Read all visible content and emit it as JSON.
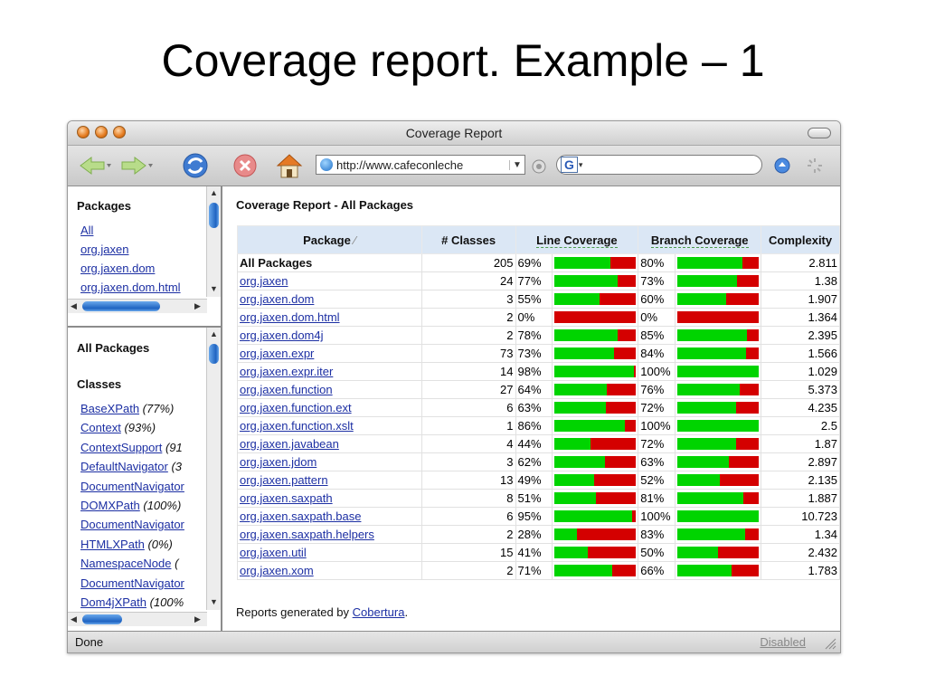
{
  "slide": {
    "title": "Coverage report. Example – 1"
  },
  "window": {
    "title": "Coverage Report",
    "url": "http://www.cafeconleche",
    "search_engine": "G"
  },
  "left_top": {
    "heading": "Packages",
    "items": [
      "All",
      "org.jaxen",
      "org.jaxen.dom",
      "org.jaxen.dom.html"
    ]
  },
  "left_bottom": {
    "heading": "All Packages",
    "subheading": "Classes",
    "classes": [
      {
        "name": "BaseXPath",
        "pct": "(77%)"
      },
      {
        "name": "Context",
        "pct": "(93%)"
      },
      {
        "name": "ContextSupport",
        "pct": "(91"
      },
      {
        "name": "DefaultNavigator",
        "pct": "(3"
      },
      {
        "name": "DocumentNavigator",
        "pct": ""
      },
      {
        "name": "DOMXPath",
        "pct": "(100%)"
      },
      {
        "name": "DocumentNavigator",
        "pct": ""
      },
      {
        "name": "HTMLXPath",
        "pct": "(0%)"
      },
      {
        "name": "NamespaceNode",
        "pct": "("
      },
      {
        "name": "DocumentNavigator",
        "pct": ""
      },
      {
        "name": "Dom4jXPath",
        "pct": "(100%"
      }
    ]
  },
  "main": {
    "title": "Coverage Report - All Packages",
    "headers": {
      "package": "Package",
      "classes": "# Classes",
      "line": "Line Coverage",
      "branch": "Branch Coverage",
      "complexity": "Complexity"
    },
    "rows": [
      {
        "name": "All Packages",
        "classes": "205",
        "line": "69%",
        "line_val": 0.69,
        "branch": "80%",
        "branch_val": 0.8,
        "complexity": "2.811",
        "summary": true
      },
      {
        "name": "org.jaxen",
        "classes": "24",
        "line": "77%",
        "line_val": 0.77,
        "branch": "73%",
        "branch_val": 0.73,
        "complexity": "1.38"
      },
      {
        "name": "org.jaxen.dom",
        "classes": "3",
        "line": "55%",
        "line_val": 0.55,
        "branch": "60%",
        "branch_val": 0.6,
        "complexity": "1.907"
      },
      {
        "name": "org.jaxen.dom.html",
        "classes": "2",
        "line": "0%",
        "line_val": 0.0,
        "branch": "0%",
        "branch_val": 0.0,
        "complexity": "1.364"
      },
      {
        "name": "org.jaxen.dom4j",
        "classes": "2",
        "line": "78%",
        "line_val": 0.78,
        "branch": "85%",
        "branch_val": 0.85,
        "complexity": "2.395"
      },
      {
        "name": "org.jaxen.expr",
        "classes": "73",
        "line": "73%",
        "line_val": 0.73,
        "branch": "84%",
        "branch_val": 0.84,
        "complexity": "1.566"
      },
      {
        "name": "org.jaxen.expr.iter",
        "classes": "14",
        "line": "98%",
        "line_val": 0.98,
        "branch": "100%",
        "branch_val": 1.0,
        "complexity": "1.029"
      },
      {
        "name": "org.jaxen.function",
        "classes": "27",
        "line": "64%",
        "line_val": 0.64,
        "branch": "76%",
        "branch_val": 0.76,
        "complexity": "5.373"
      },
      {
        "name": "org.jaxen.function.ext",
        "classes": "6",
        "line": "63%",
        "line_val": 0.63,
        "branch": "72%",
        "branch_val": 0.72,
        "complexity": "4.235"
      },
      {
        "name": "org.jaxen.function.xslt",
        "classes": "1",
        "line": "86%",
        "line_val": 0.86,
        "branch": "100%",
        "branch_val": 1.0,
        "complexity": "2.5"
      },
      {
        "name": "org.jaxen.javabean",
        "classes": "4",
        "line": "44%",
        "line_val": 0.44,
        "branch": "72%",
        "branch_val": 0.72,
        "complexity": "1.87"
      },
      {
        "name": "org.jaxen.jdom",
        "classes": "3",
        "line": "62%",
        "line_val": 0.62,
        "branch": "63%",
        "branch_val": 0.63,
        "complexity": "2.897"
      },
      {
        "name": "org.jaxen.pattern",
        "classes": "13",
        "line": "49%",
        "line_val": 0.49,
        "branch": "52%",
        "branch_val": 0.52,
        "complexity": "2.135"
      },
      {
        "name": "org.jaxen.saxpath",
        "classes": "8",
        "line": "51%",
        "line_val": 0.51,
        "branch": "81%",
        "branch_val": 0.81,
        "complexity": "1.887"
      },
      {
        "name": "org.jaxen.saxpath.base",
        "classes": "6",
        "line": "95%",
        "line_val": 0.95,
        "branch": "100%",
        "branch_val": 1.0,
        "complexity": "10.723"
      },
      {
        "name": "org.jaxen.saxpath.helpers",
        "classes": "2",
        "line": "28%",
        "line_val": 0.28,
        "branch": "83%",
        "branch_val": 0.83,
        "complexity": "1.34"
      },
      {
        "name": "org.jaxen.util",
        "classes": "15",
        "line": "41%",
        "line_val": 0.41,
        "branch": "50%",
        "branch_val": 0.5,
        "complexity": "2.432"
      },
      {
        "name": "org.jaxen.xom",
        "classes": "2",
        "line": "71%",
        "line_val": 0.71,
        "branch": "66%",
        "branch_val": 0.66,
        "complexity": "1.783"
      }
    ],
    "footer_prefix": "Reports generated by ",
    "footer_link": "Cobertura",
    "footer_suffix": "."
  },
  "statusbar": {
    "left": "Done",
    "right": "Disabled"
  },
  "colors": {
    "covered": "#00d400",
    "uncovered": "#d40000",
    "header_bg": "#dbe7f5",
    "link": "#1c2fa3"
  }
}
